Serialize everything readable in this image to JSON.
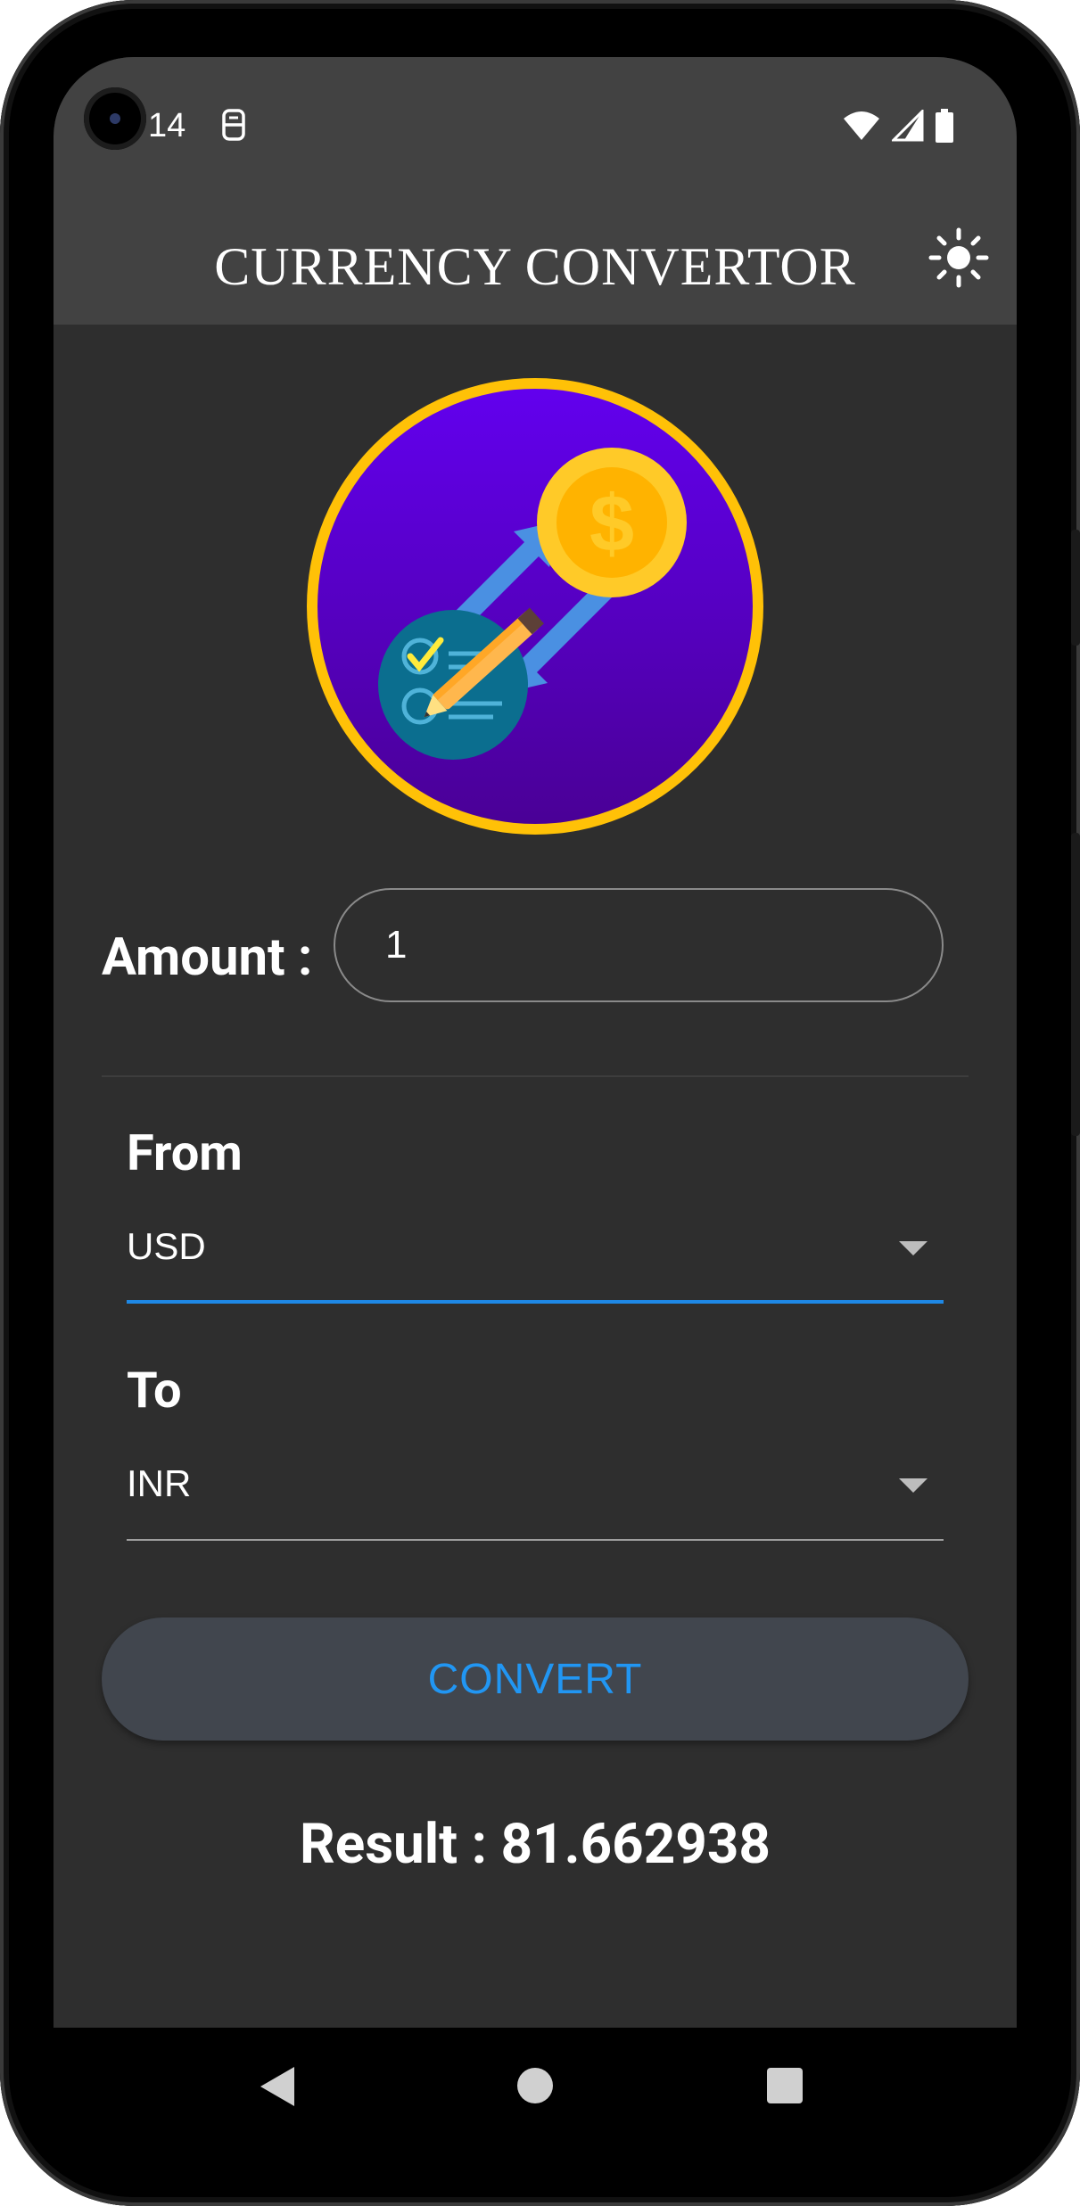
{
  "status_bar": {
    "time": "14",
    "icons": [
      "notification-icon",
      "wifi-icon",
      "signal-icon",
      "battery-icon"
    ]
  },
  "app_bar": {
    "title": "CURRENCY CONVERTOR",
    "theme_icon": "sun-icon"
  },
  "logo": {
    "icon": "currency-exchange-logo",
    "ring_color": "#ffc107",
    "fill_color": "#5a00e6"
  },
  "amount": {
    "label": "Amount :",
    "value": "1"
  },
  "from": {
    "label": "From",
    "selected": "USD"
  },
  "to": {
    "label": "To",
    "selected": "INR"
  },
  "convert_button": {
    "label": "CONVERT"
  },
  "result": {
    "text": "Result : 81.662938"
  },
  "nav_bar": {
    "icons": [
      "back-icon",
      "home-icon",
      "recents-icon"
    ]
  },
  "colors": {
    "accent": "#2196f3",
    "background": "#2e2e2e",
    "app_bar": "#424242"
  }
}
